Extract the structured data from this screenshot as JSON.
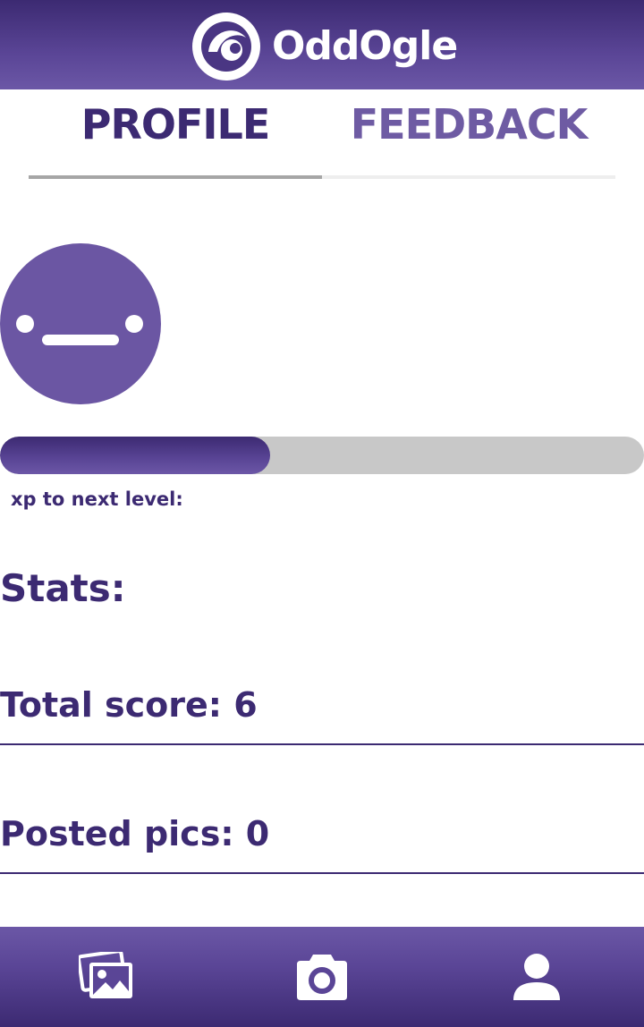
{
  "app": {
    "title": "OddOgle",
    "logo_icon": "oddogle-eye-icon"
  },
  "tabs": [
    {
      "label": "PROFILE",
      "active": true
    },
    {
      "label": "FEEDBACK",
      "active": false
    }
  ],
  "profile": {
    "avatar_icon": "neutral-face-icon",
    "xp_progress_fraction": 0.42,
    "xp_label": "xp to next level:",
    "stats_title": "Stats:",
    "stats": [
      {
        "text": "Total score: 6"
      },
      {
        "text": "Posted pics: 0"
      }
    ]
  },
  "bottom_nav": [
    {
      "icon": "gallery-icon"
    },
    {
      "icon": "camera-icon"
    },
    {
      "icon": "user-icon"
    }
  ],
  "colors": {
    "brand_dark": "#3c2a72",
    "brand_light": "#6b57a6",
    "track": "#c8c8c8"
  }
}
